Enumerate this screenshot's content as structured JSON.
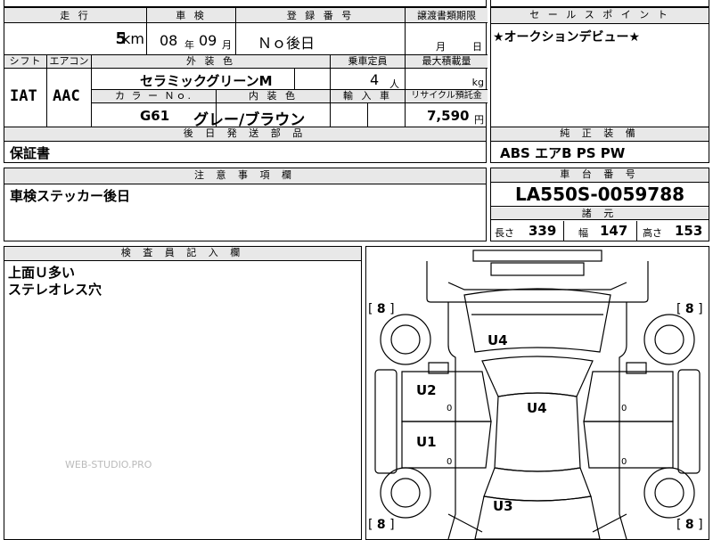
{
  "header_row": {
    "mileage_label": "走 行",
    "inspection_label": "車 検",
    "registration_label": "登 録 番 号",
    "transfer_label": "譲渡書類期限",
    "mileage_value": "5",
    "mileage_unit": "km",
    "inspection_year": "08",
    "year_unit": "年",
    "inspection_month": "09",
    "month_unit": "月",
    "registration_value": "Ｎｏ後日",
    "transfer_month_unit": "月",
    "transfer_day_unit": "日"
  },
  "row2": {
    "shift_label": "シフト",
    "ac_label": "エアコン",
    "exterior_color_label": "外 装 色",
    "capacity_label": "乗車定員",
    "max_load_label": "最大積載量",
    "shift_value": "IAT",
    "ac_value": "AAC",
    "exterior_color_value": "セラミックグリーンM",
    "capacity_value": "4",
    "capacity_unit": "人",
    "load_unit": "kg",
    "color_no_label": "カ ラ ー Ｎｏ.",
    "interior_color_label": "内 装 色",
    "import_label": "輸 入 車",
    "recycle_label": "リサイクル預託金",
    "color_no_value": "G61",
    "interior_color_value": "グレー/ブラウン",
    "recycle_value": "7,590",
    "recycle_unit": "円"
  },
  "sales_point": {
    "label": "セ ー ル ス ポ イ ン ト",
    "text": "★オークションデビュー★"
  },
  "later_parts": {
    "label": "後 日 発 送 部 品",
    "text": "保証書"
  },
  "equipment": {
    "label": "純 正 装 備",
    "text": "ABS エアB PS PW"
  },
  "notes": {
    "label": "注 意 事 項 欄",
    "text": "車検ステッカー後日"
  },
  "chassis": {
    "label": "車 台 番 号",
    "value": "LA550S-0059788",
    "spec_label": "諸 元",
    "length_label": "長さ",
    "length_value": "339",
    "width_label": "幅",
    "width_value": "147",
    "height_label": "高さ",
    "height_value": "153"
  },
  "inspector": {
    "label": "検 査 員 記 入 欄",
    "line1": "上面Ｕ多い",
    "line2": "ステレオレス穴"
  },
  "diagram": {
    "tire_fl": "8",
    "tire_fr": "8",
    "tire_rl": "8",
    "tire_rr": "8",
    "hood_mark": "U4",
    "roof_mark": "U4",
    "left_rear_door_mark": "U2",
    "left_front_door_mark": "U1",
    "trunk_mark": "U3",
    "zero": "0"
  },
  "watermark": "WEB-STUDIO.PRO"
}
